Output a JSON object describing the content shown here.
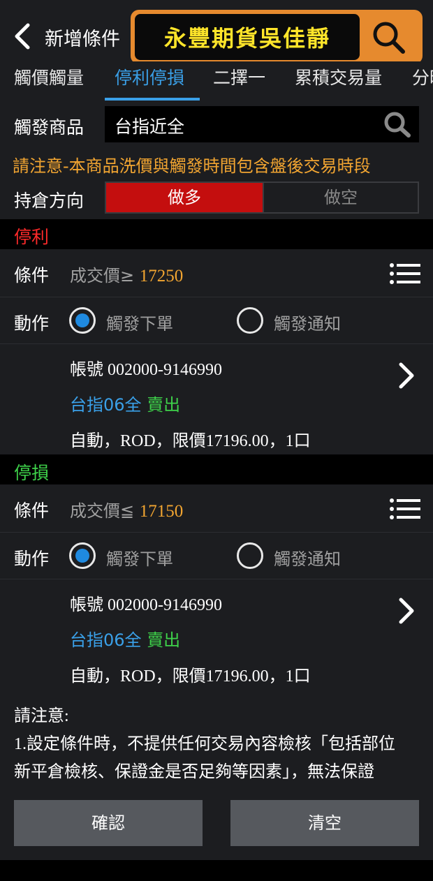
{
  "header": {
    "title": "新增條件",
    "brand_text": "永豐期貨吳佳靜",
    "colors": {
      "brand_border": "#e68a2e",
      "brand_text": "#ffe52a"
    }
  },
  "tabs": [
    {
      "label": "觸價觸量",
      "active": false
    },
    {
      "label": "停利停損",
      "active": true
    },
    {
      "label": "二擇一",
      "active": false
    },
    {
      "label": "累積交易量",
      "active": false
    },
    {
      "label": "分時",
      "active": false
    }
  ],
  "product": {
    "label": "觸發商品",
    "value": "台指近全"
  },
  "notice": "請注意-本商品洗價與觸發時間包含盤後交易時段",
  "direction": {
    "label": "持倉方向",
    "long": "做多",
    "short": "做空",
    "selected": "做多"
  },
  "take_profit": {
    "heading": "停利",
    "cond_label": "條件",
    "cond_prefix": "成交價≥",
    "cond_value": "17250",
    "action_label": "動作",
    "opt_order": "觸發下單",
    "opt_notify": "觸發通知",
    "selected": "觸發下單",
    "account": "帳號 002000-9146990",
    "product": "台指06全",
    "side": "賣出",
    "order": "自動，ROD，限價17196.00，1口"
  },
  "stop_loss": {
    "heading": "停損",
    "cond_label": "條件",
    "cond_prefix": "成交價≦",
    "cond_value": "17150",
    "action_label": "動作",
    "opt_order": "觸發下單",
    "opt_notify": "觸發通知",
    "selected": "觸發下單",
    "account": "帳號 002000-9146990",
    "product": "台指06全",
    "side": "賣出",
    "order": "自動，ROD，限價17196.00，1口"
  },
  "notes": {
    "title": "請注意:",
    "line1": "1.設定條件時，不提供任何交易內容檢核「包括部位",
    "line2": "新平倉檢核、保證金是否足夠等因素」，無法保證"
  },
  "buttons": {
    "confirm": "確認",
    "clear": "清空"
  }
}
